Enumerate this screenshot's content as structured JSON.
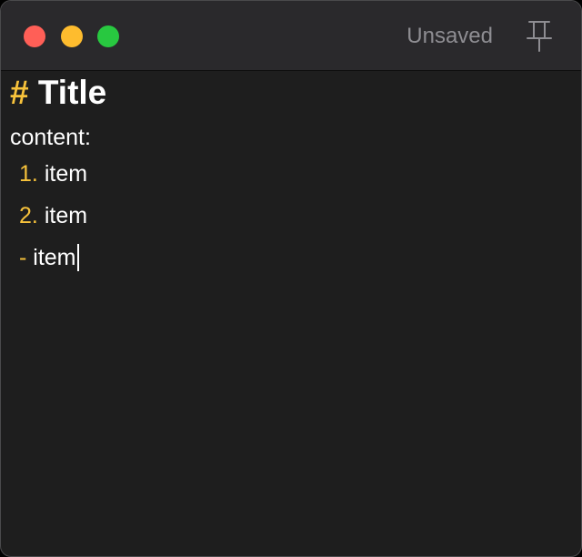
{
  "window": {
    "status": "Unsaved",
    "colors": {
      "close": "#ff5f57",
      "minimize": "#febc2e",
      "zoom": "#28c840",
      "accent": "#f7c23b",
      "background": "#1e1e1e",
      "titlebar": "#2a292c",
      "text": "#ffffff",
      "status_text": "#8e8d92"
    },
    "icons": {
      "pin": "pushpin-icon"
    }
  },
  "document": {
    "heading": {
      "marker": "#",
      "text": "Title"
    },
    "intro": "content:",
    "items": [
      {
        "marker": "1.",
        "text": "item"
      },
      {
        "marker": "2.",
        "text": "item"
      },
      {
        "marker": "-",
        "text": "item"
      }
    ]
  }
}
